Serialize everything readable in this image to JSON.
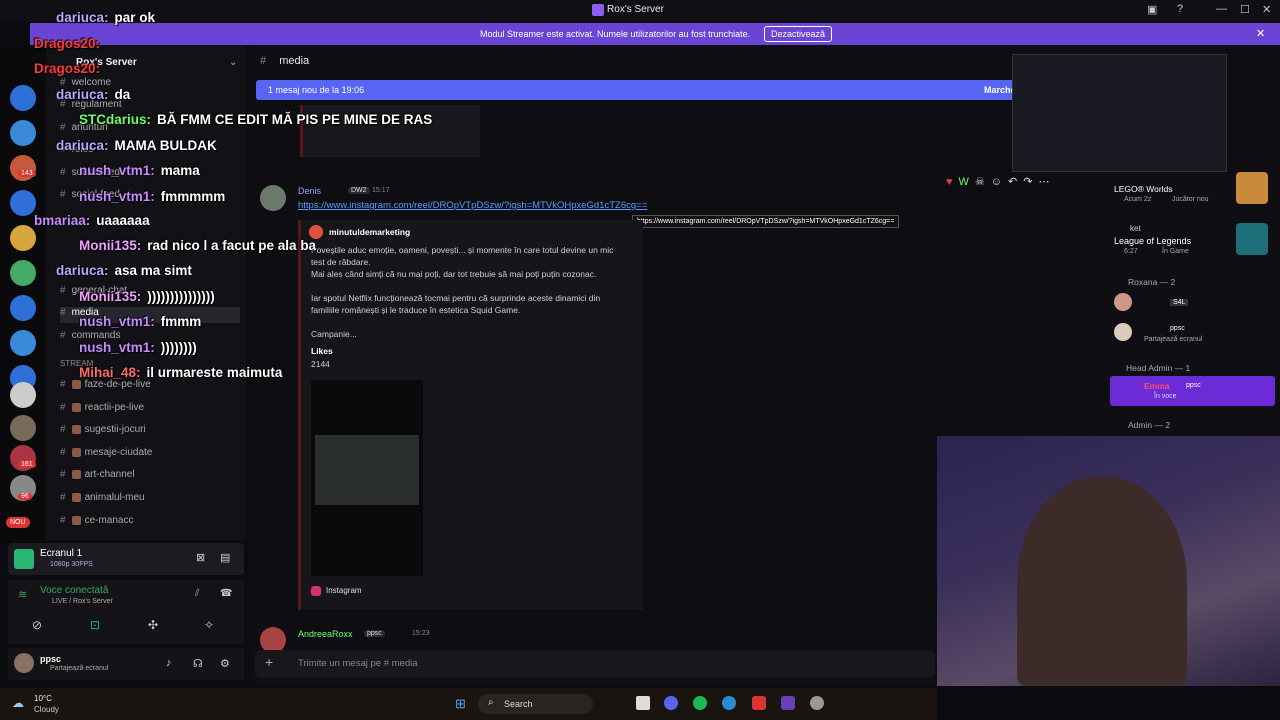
{
  "titlebar": {
    "title": "Rox's Server"
  },
  "banner": {
    "message": "Modul Streamer este activat. Numele utilizatorilor au fost trunchiate.",
    "button": "Dezactivează"
  },
  "server": {
    "name": "Rox's Server"
  },
  "guild_badges": [
    "143",
    "161",
    "96"
  ],
  "guild_new_label": "NOU",
  "channels": [
    {
      "name": "welcome"
    },
    {
      "name": "regulament"
    },
    {
      "name": "anunturi"
    },
    {
      "name": "roles"
    },
    {
      "name": "social-feed"
    },
    {
      "name": "social-feed"
    },
    {
      "name": "general-chat"
    },
    {
      "name": "media"
    },
    {
      "name": "commands"
    },
    {
      "name": "STREAM"
    },
    {
      "name": "faze-de-pe-live"
    },
    {
      "name": "reactii-pe-live"
    },
    {
      "name": "sugestii-jocuri"
    },
    {
      "name": "mesaje-ciudate"
    },
    {
      "name": "art-channel"
    },
    {
      "name": "animalul-meu"
    },
    {
      "name": "ce-manacc"
    }
  ],
  "stream_panel": {
    "title": "Ecranul 1",
    "subtitle": "1080p 30FPS"
  },
  "voice_panel": {
    "status": "Voce conectată",
    "where": "LIVE / Rox's Server"
  },
  "user_panel": {
    "name": "ppsc",
    "status": "Partajează ecranul"
  },
  "channel_header": {
    "name": "media"
  },
  "new_messages_bar": {
    "text": "1 mesaj nou de la 19:06",
    "right": "Marchează"
  },
  "message": {
    "author": "Denis",
    "tag": "DW2",
    "time": "15:17",
    "link": "https://www.instagram.com/reel/DROpVTpDSzw/?igsh=MTVkOHpxeGd1cTZ6cg==",
    "tooltip": "https://www.instagram.com/reel/DROpVTpDSzw/?igsh=MTVkOHpxeGd1cTZ6cg==",
    "embed": {
      "account": "minutuldemarketing",
      "body1": "Poveștile aduc emoție, oameni, povești... și momente în care totul devine un mic",
      "body2": "test de răbdare.",
      "body3": "Mai ales când simți că nu mai poți, dar tot trebuie să mai poți puțin cozonac.",
      "body4": "Iar spotul Netflix funcționează tocmai pentru că surprinde aceste dinamici din",
      "body5": "familiile românești și le traduce în estetica Squid Game.",
      "body6": "Campanie...",
      "likes_label": "Likes",
      "likes_value": "2144",
      "footer": "Instagram"
    }
  },
  "message2": {
    "author": "AndreeaRoxx",
    "tag": "ppsc",
    "time": "15:23"
  },
  "composer": {
    "placeholder": "Trimite un mesaj pe #",
    "channel": "media"
  },
  "chat_overlay": [
    {
      "nick": "dariuca:",
      "text": "par ok",
      "color": "#b8a6ff"
    },
    {
      "nick": "Dragos20:",
      "text": "",
      "color": "#ff3b3b"
    },
    {
      "nick": "Dragos20:",
      "text": "",
      "color": "#ff3b3b"
    },
    {
      "nick": "dariuca:",
      "text": "da",
      "color": "#b8a6ff"
    },
    {
      "nick": "STCdarius:",
      "text": "BĂ FMM CE EDIT MĂ PIS PE MINE DE RAS",
      "color": "#6cff6c"
    },
    {
      "nick": "dariuca:",
      "text": "MAMA BULDAK",
      "color": "#b8a6ff"
    },
    {
      "nick": "nush_vtm1:",
      "text": "mama",
      "color": "#c58cff"
    },
    {
      "nick": "nush_vtm1:",
      "text": "fmmmmm",
      "color": "#c58cff"
    },
    {
      "nick": "bmariaa:",
      "text": "uaaaaaa",
      "color": "#c58cff"
    },
    {
      "nick": "Monii135:",
      "text": "rad nico l a facut pe ala ba",
      "color": "#f0a0ff"
    },
    {
      "nick": "dariuca:",
      "text": "asa ma simt",
      "color": "#b8a6ff"
    },
    {
      "nick": "Monii135:",
      "text": ")))))))))))))))",
      "color": "#f0a0ff"
    },
    {
      "nick": "nush_vtm1:",
      "text": "fmmm",
      "color": "#c58cff"
    },
    {
      "nick": "nush_vtm1:",
      "text": "))))))))",
      "color": "#c58cff"
    },
    {
      "nick": "Mihai_48:",
      "text": "il urmareste maimuta",
      "color": "#ff6b6b"
    }
  ],
  "right_panel": {
    "activity1_title": "LEGO® Worlds",
    "activity1_sub": "Acum 2z",
    "activity1_extra": "Jucător nou",
    "activity2_user": "ket",
    "activity2_title": "League of Legends",
    "activity2_sub": "6:27",
    "activity2_extra": "În Game",
    "section1": "Roxana — 2",
    "member1_name": "S4L",
    "member2_name": "ppsc",
    "member2_status": "Partajează ecranul",
    "section2": "Head Admin — 1",
    "member3_name": "Emma",
    "member3_tag": "ppsc",
    "member3_status": "În voce",
    "section3": "Admin — 2"
  },
  "weather": {
    "temp": "10°C",
    "desc": "Cloudy"
  },
  "taskbar": {
    "search": "Search"
  }
}
